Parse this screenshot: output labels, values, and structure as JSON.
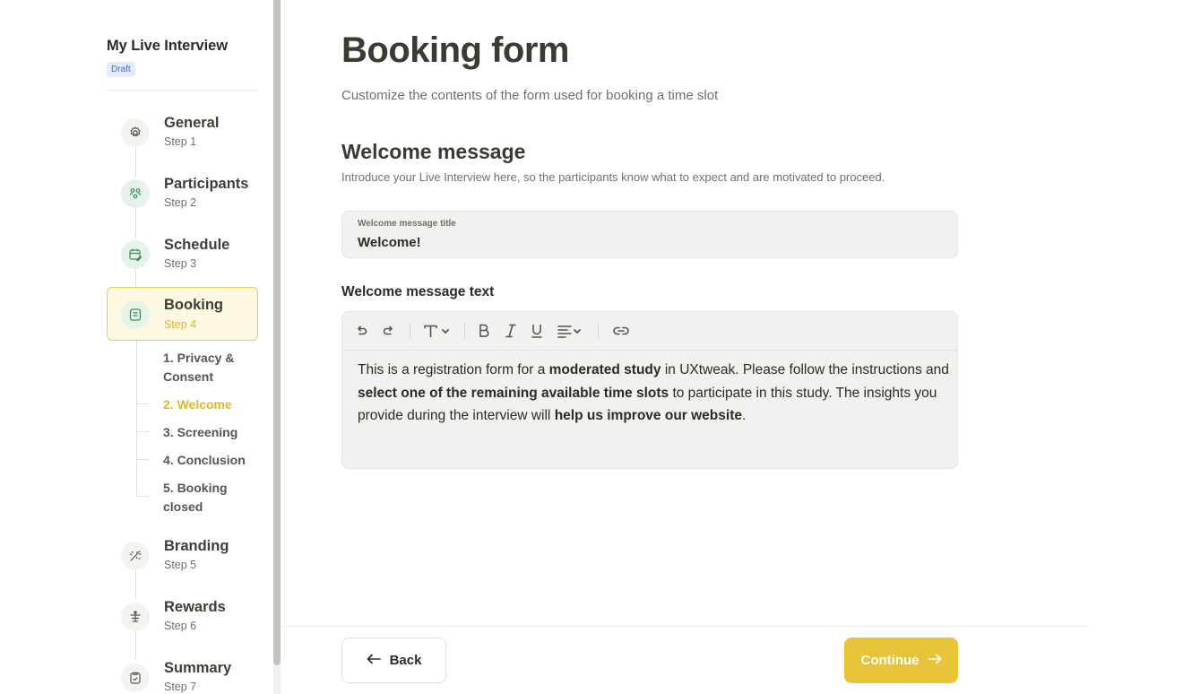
{
  "sidebar": {
    "project_title": "My Live Interview",
    "status_badge": "Draft",
    "steps": [
      {
        "name": "General",
        "sub": "Step 1",
        "icon": "gear-icon"
      },
      {
        "name": "Participants",
        "sub": "Step 2",
        "icon": "people-icon"
      },
      {
        "name": "Schedule",
        "sub": "Step 3",
        "icon": "calendar-edit-icon"
      },
      {
        "name": "Booking",
        "sub": "Step 4",
        "icon": "form-icon"
      },
      {
        "name": "Branding",
        "sub": "Step 5",
        "icon": "magic-wand-icon"
      },
      {
        "name": "Rewards",
        "sub": "Step 6",
        "icon": "gift-icon"
      },
      {
        "name": "Summary",
        "sub": "Step 7",
        "icon": "clipboard-check-icon"
      }
    ],
    "substeps": [
      "1. Privacy & Consent",
      "2. Welcome",
      "3. Screening",
      "4. Conclusion",
      "5. Booking closed"
    ],
    "active_step": "Booking",
    "active_substep": "2. Welcome"
  },
  "main": {
    "title": "Booking form",
    "subtitle": "Customize the contents of the form used for booking a time slot",
    "section_title": "Welcome message",
    "section_desc": "Introduce your Live Interview here, so the participants know what to expect and are motivated to proceed.",
    "title_field": {
      "label": "Welcome message title",
      "value": "Welcome!"
    },
    "text_label": "Welcome message text",
    "toolbar": [
      "undo-icon",
      "redo-icon",
      "text-style-icon",
      "bold-icon",
      "italic-icon",
      "underline-icon",
      "align-icon",
      "link-icon"
    ],
    "body": {
      "p1": "This is a registration form for a ",
      "b1": "moderated study",
      "p2": " in UXtweak. Please follow the instructions and ",
      "b2": "select one of the remaining available time slots",
      "p3": " to participate in this study. The insights you provide during the interview will ",
      "b3": "help us improve our website",
      "p4": "."
    }
  },
  "footer": {
    "back_label": "Back",
    "continue_label": "Continue"
  },
  "colors": {
    "accent": "#e8c43a",
    "active_bg": "#fdf8e2",
    "done_icon_bg": "#e6f3ea",
    "draft_badge": "#3a6ed8"
  }
}
